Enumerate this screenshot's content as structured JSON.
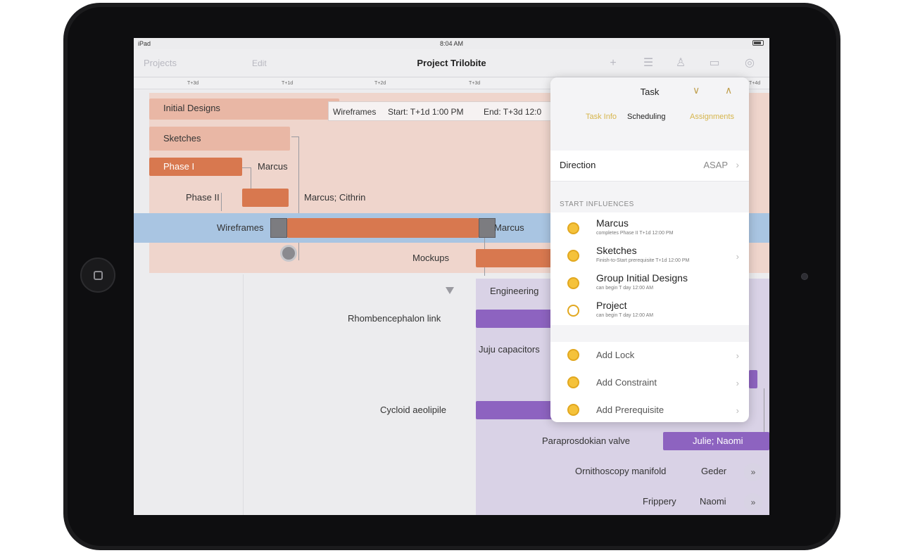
{
  "device": {
    "carrier": "iPad",
    "time": "8:04 AM"
  },
  "toolbar": {
    "back_label": "Projects",
    "edit_label": "Edit",
    "title": "Project Trilobite"
  },
  "timeline": {
    "ticks": [
      "T+3d",
      "T+1d",
      "T+2d",
      "T+3d",
      "T+4d"
    ]
  },
  "gantt": {
    "initial_designs": "Initial Designs",
    "sketches": "Sketches",
    "phase1": "Phase I",
    "phase1_assignee": "Marcus",
    "phase2": "Phase II",
    "phase2_assignee": "Marcus; Cithrin",
    "wireframes": "Wireframes",
    "wireframes_assignee": "Marcus",
    "mockups": "Mockups",
    "engineering": "Engineering",
    "rhombencephalon": "Rhombencephalon link",
    "juju": "Juju capacitors",
    "cycloid": "Cycloid aeolipile",
    "paraprosdokian": "Paraprosdokian valve",
    "paraprosdokian_assignee": "Julie; Naomi",
    "ornithoscopy": "Ornithoscopy manifold",
    "ornithoscopy_assignee": "Geder",
    "frippery": "Frippery",
    "frippery_assignee": "Naomi",
    "more_symbol": "»"
  },
  "tooltip": {
    "name": "Wireframes",
    "start": "Start: T+1d 1:00 PM",
    "end": "End: T+3d 12:0"
  },
  "popover": {
    "title": "Task",
    "tabs": [
      "Task Info",
      "Scheduling",
      "Assignments"
    ],
    "direction_label": "Direction",
    "direction_value": "ASAP",
    "section_title": "START INFLUENCES",
    "influences": [
      {
        "name": "Marcus",
        "sub": "completes Phase II T+1d 12:00 PM"
      },
      {
        "name": "Sketches",
        "sub": "Finish-to-Start prerequisite T+1d 12:00 PM"
      },
      {
        "name": "Group Initial Designs",
        "sub": "can begin T day 12:00 AM"
      },
      {
        "name": "Project",
        "sub": "can begin T day 12:00 AM"
      }
    ],
    "actions": [
      "Add Lock",
      "Add Constraint",
      "Add Prerequisite"
    ]
  }
}
